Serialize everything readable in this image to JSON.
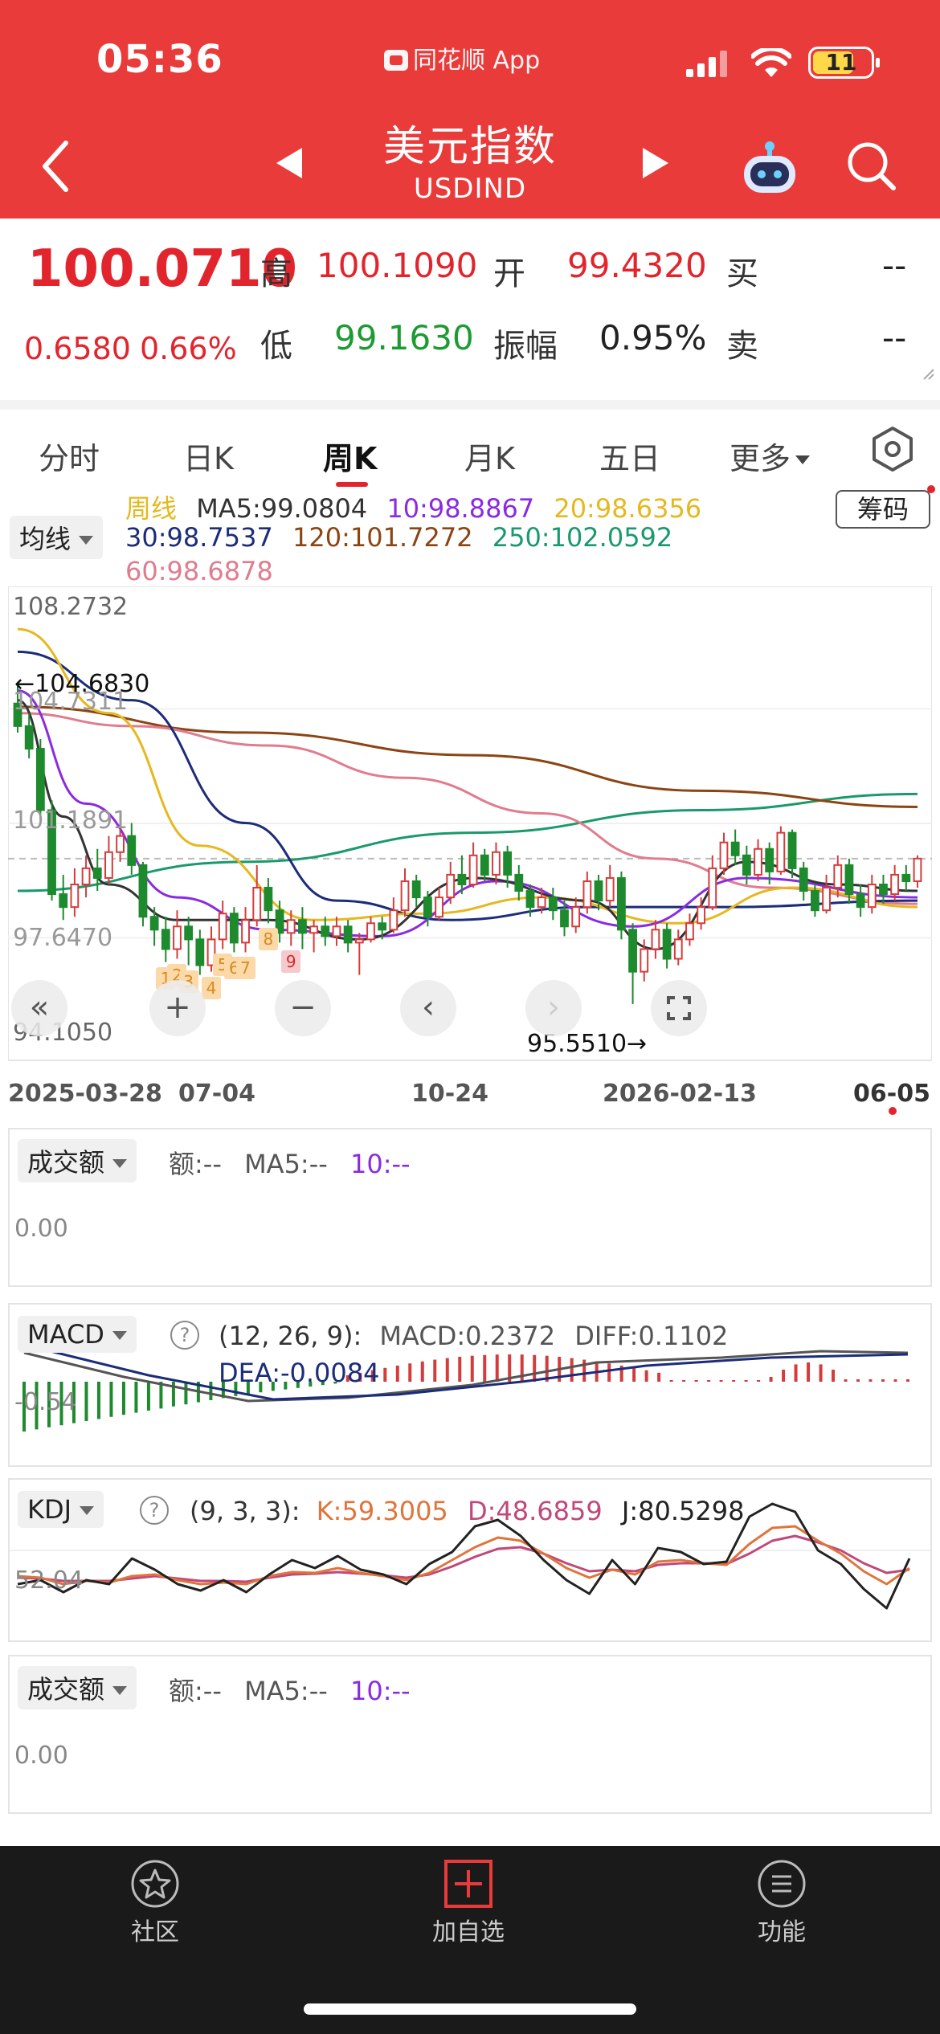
{
  "status": {
    "time": "05:36",
    "app": "同花顺 App",
    "battery": "11"
  },
  "header": {
    "title": "美元指数",
    "subtitle": "USDIND"
  },
  "quote": {
    "price": "100.0710",
    "change": "0.6580",
    "change_pct": "0.66%",
    "high_label": "高",
    "high": "100.1090",
    "open_label": "开",
    "open": "99.4320",
    "buy_label": "买",
    "buy": "--",
    "low_label": "低",
    "low": "99.1630",
    "amp_label": "振幅",
    "amp": "0.95%",
    "sell_label": "卖",
    "sell": "--"
  },
  "tabs": [
    "分时",
    "日K",
    "周K",
    "月K",
    "五日",
    "更多"
  ],
  "ma": {
    "type_label": "均线",
    "period": "周线",
    "ma5": "MA5:99.0804",
    "ma10": "10:98.8867",
    "ma20": "20:98.6356",
    "ma30": "30:98.7537",
    "ma120": "120:101.7272",
    "ma250": "250:102.0592",
    "ma60": "60:98.6878",
    "chip_button": "筹码"
  },
  "colors": {
    "ma5": "#333333",
    "ma10": "#8a2be2",
    "ma20": "#e6b820",
    "ma30": "#1c2c7a",
    "ma60": "#e07c8e",
    "ma120": "#8b4513",
    "ma250": "#1a9a6a",
    "up": "#d43c3c",
    "down": "#1e8a2e"
  },
  "kline": {
    "y_labels": [
      "108.2732",
      "104.7311",
      "101.1891",
      "97.6470",
      "94.1050"
    ],
    "high_marker": "←104.6830",
    "low_marker": "95.5510→",
    "x_labels": [
      "2025-03-28",
      "07-04",
      "10-24",
      "2026-02-13",
      "06-05"
    ],
    "seq_nums": [
      "1",
      "2",
      "3",
      "4",
      "5",
      "6",
      "7",
      "8",
      "9"
    ]
  },
  "chart_data": {
    "type": "candlestick",
    "period": "weekly",
    "y_range": [
      94.105,
      108.2732
    ],
    "x_range": [
      "2025-03-28",
      "2026-06-05"
    ],
    "candles": [
      [
        104.9,
        104.2,
        105.5,
        104.0
      ],
      [
        104.2,
        103.5,
        104.6,
        103.2
      ],
      [
        103.5,
        101.6,
        103.8,
        101.3
      ],
      [
        101.6,
        99.0,
        101.9,
        98.8
      ],
      [
        99.0,
        98.6,
        99.6,
        98.2
      ],
      [
        98.6,
        99.3,
        99.8,
        98.3
      ],
      [
        99.3,
        99.8,
        100.2,
        98.9
      ],
      [
        99.8,
        99.5,
        100.4,
        99.1
      ],
      [
        99.5,
        100.3,
        100.8,
        99.3
      ],
      [
        100.3,
        100.8,
        101.4,
        100.0
      ],
      [
        100.8,
        99.9,
        101.2,
        99.6
      ],
      [
        99.9,
        98.3,
        100.0,
        98.0
      ],
      [
        98.3,
        97.9,
        98.6,
        97.4
      ],
      [
        97.9,
        97.3,
        98.3,
        96.9
      ],
      [
        97.3,
        98.0,
        98.5,
        97.0
      ],
      [
        98.0,
        97.6,
        98.3,
        96.8
      ],
      [
        97.6,
        96.8,
        97.9,
        96.5
      ],
      [
        96.8,
        97.6,
        98.0,
        96.6
      ],
      [
        97.6,
        98.4,
        98.8,
        97.3
      ],
      [
        98.4,
        97.5,
        98.6,
        97.2
      ],
      [
        97.5,
        98.2,
        98.6,
        97.2
      ],
      [
        98.2,
        99.2,
        99.9,
        98.0
      ],
      [
        99.2,
        98.5,
        99.5,
        98.1
      ],
      [
        98.5,
        97.8,
        98.8,
        97.5
      ],
      [
        97.8,
        98.2,
        98.5,
        97.4
      ],
      [
        98.2,
        97.8,
        98.6,
        97.3
      ],
      [
        97.8,
        98.0,
        98.2,
        97.2
      ],
      [
        98.0,
        97.7,
        98.3,
        97.4
      ],
      [
        97.7,
        98.0,
        98.3,
        97.4
      ],
      [
        98.0,
        97.5,
        98.2,
        97.2
      ],
      [
        97.5,
        97.6,
        97.8,
        96.5
      ],
      [
        97.6,
        98.1,
        98.3,
        97.5
      ],
      [
        98.1,
        97.9,
        98.3,
        97.6
      ],
      [
        97.9,
        98.5,
        98.9,
        97.8
      ],
      [
        98.5,
        99.4,
        99.8,
        98.3
      ],
      [
        99.4,
        98.9,
        99.6,
        98.6
      ],
      [
        98.9,
        98.3,
        99.1,
        98.0
      ],
      [
        98.3,
        98.9,
        99.2,
        98.2
      ],
      [
        98.9,
        99.6,
        100.0,
        98.7
      ],
      [
        99.6,
        99.3,
        100.2,
        99.0
      ],
      [
        99.3,
        100.2,
        100.6,
        99.2
      ],
      [
        100.2,
        99.6,
        100.4,
        99.4
      ],
      [
        99.6,
        100.3,
        100.6,
        99.3
      ],
      [
        100.3,
        99.6,
        100.5,
        99.2
      ],
      [
        99.6,
        99.1,
        99.9,
        98.8
      ],
      [
        99.1,
        98.6,
        99.3,
        98.3
      ],
      [
        98.6,
        98.9,
        99.2,
        98.4
      ],
      [
        98.9,
        98.5,
        99.2,
        98.2
      ],
      [
        98.5,
        98.0,
        98.8,
        97.7
      ],
      [
        98.0,
        98.6,
        98.9,
        97.8
      ],
      [
        98.6,
        99.4,
        99.7,
        98.4
      ],
      [
        99.4,
        98.8,
        99.6,
        98.5
      ],
      [
        98.8,
        99.5,
        99.9,
        98.6
      ],
      [
        99.5,
        97.9,
        99.7,
        97.6
      ],
      [
        97.9,
        96.6,
        98.1,
        95.6
      ],
      [
        96.6,
        97.3,
        97.6,
        96.3
      ],
      [
        97.3,
        97.9,
        98.2,
        97.0
      ],
      [
        97.9,
        97.0,
        98.1,
        96.7
      ],
      [
        97.0,
        97.6,
        97.9,
        96.8
      ],
      [
        97.6,
        98.1,
        98.4,
        97.4
      ],
      [
        98.1,
        98.6,
        98.9,
        97.9
      ],
      [
        98.6,
        99.8,
        100.2,
        98.5
      ],
      [
        99.8,
        100.6,
        100.9,
        99.6
      ],
      [
        100.6,
        100.2,
        101.0,
        99.9
      ],
      [
        100.2,
        99.6,
        100.5,
        99.3
      ],
      [
        99.6,
        100.4,
        100.7,
        99.4
      ],
      [
        100.4,
        99.7,
        100.6,
        99.3
      ],
      [
        99.7,
        100.9,
        101.1,
        99.6
      ],
      [
        100.9,
        99.8,
        101.0,
        99.5
      ],
      [
        99.8,
        99.1,
        100.0,
        98.8
      ],
      [
        99.1,
        98.5,
        99.3,
        98.3
      ],
      [
        98.5,
        99.2,
        99.6,
        98.4
      ],
      [
        99.2,
        99.9,
        100.2,
        98.9
      ],
      [
        99.9,
        99.0,
        100.1,
        98.7
      ],
      [
        99.0,
        98.6,
        99.3,
        98.3
      ],
      [
        98.6,
        99.3,
        99.6,
        98.4
      ],
      [
        99.3,
        99.0,
        99.6,
        98.7
      ],
      [
        99.0,
        99.6,
        99.9,
        98.8
      ],
      [
        99.6,
        99.4,
        99.9,
        99.1
      ],
      [
        99.4,
        100.1,
        100.2,
        99.2
      ]
    ],
    "ma_lines": {
      "MA5": [
        [
          0,
          105.0
        ],
        [
          4,
          101.4
        ],
        [
          8,
          99.3
        ],
        [
          14,
          98.2
        ],
        [
          22,
          98.2
        ],
        [
          30,
          97.6
        ],
        [
          40,
          99.5
        ],
        [
          50,
          98.8
        ],
        [
          56,
          97.3
        ],
        [
          64,
          100.0
        ],
        [
          72,
          99.3
        ],
        [
          79,
          99.1
        ]
      ],
      "MA10": [
        [
          0,
          105.3
        ],
        [
          6,
          101.8
        ],
        [
          14,
          98.9
        ],
        [
          22,
          97.9
        ],
        [
          32,
          97.7
        ],
        [
          42,
          99.4
        ],
        [
          54,
          98.0
        ],
        [
          64,
          99.5
        ],
        [
          79,
          98.9
        ]
      ],
      "MA20": [
        [
          0,
          107.2
        ],
        [
          8,
          104.6
        ],
        [
          16,
          100.5
        ],
        [
          26,
          98.2
        ],
        [
          36,
          98.4
        ],
        [
          46,
          98.9
        ],
        [
          58,
          98.1
        ],
        [
          68,
          99.2
        ],
        [
          79,
          98.6
        ]
      ],
      "MA30": [
        [
          0,
          106.5
        ],
        [
          10,
          105.0
        ],
        [
          20,
          101.2
        ],
        [
          28,
          98.8
        ],
        [
          38,
          98.2
        ],
        [
          50,
          98.6
        ],
        [
          62,
          98.6
        ],
        [
          79,
          98.8
        ]
      ],
      "MA60": [
        [
          0,
          104.6
        ],
        [
          10,
          104.2
        ],
        [
          22,
          103.6
        ],
        [
          34,
          102.6
        ],
        [
          46,
          101.5
        ],
        [
          56,
          100.1
        ],
        [
          66,
          99.2
        ],
        [
          79,
          98.7
        ]
      ],
      "MA120": [
        [
          0,
          104.8
        ],
        [
          20,
          104.0
        ],
        [
          40,
          103.3
        ],
        [
          60,
          102.2
        ],
        [
          79,
          101.7
        ]
      ],
      "MA250": [
        [
          0,
          99.1
        ],
        [
          20,
          100.0
        ],
        [
          40,
          100.9
        ],
        [
          60,
          101.6
        ],
        [
          79,
          102.1
        ]
      ]
    },
    "macd": {
      "DIF": 0.1102,
      "DEA": -0.0084,
      "MACD": 0.2372,
      "y_label": "-0.54"
    },
    "kdj": {
      "K": 59.3005,
      "D": 48.6859,
      "J": 80.5298,
      "y_label": "52.04"
    }
  },
  "volume1": {
    "label": "成交额",
    "amount": "额:--",
    "ma5": "MA5:--",
    "ma10": "10:--",
    "zero": "0.00"
  },
  "macd_panel": {
    "label": "MACD",
    "help": "?",
    "params": "(12, 26, 9):",
    "macd": "MACD:0.2372",
    "diff": "DIFF:0.1102",
    "dea": "DEA:-0.0084",
    "y_label": "-0.54"
  },
  "kdj_panel": {
    "label": "KDJ",
    "help": "?",
    "params": "(9, 3, 3):",
    "k": "K:59.3005",
    "d": "D:48.6859",
    "j": "J:80.5298",
    "y_label": "52.04"
  },
  "volume2": {
    "label": "成交额",
    "amount": "额:--",
    "ma5": "MA5:--",
    "ma10": "10:--",
    "zero": "0.00"
  },
  "nav": {
    "community": "社区",
    "add_watch": "加自选",
    "functions": "功能"
  }
}
